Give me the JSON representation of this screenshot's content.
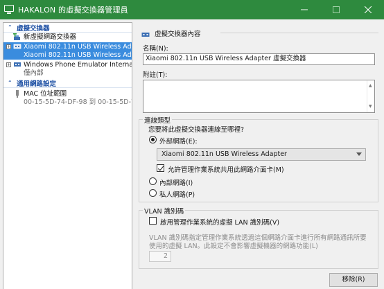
{
  "window": {
    "title": "HAKALON 的虛擬交換器管理員",
    "accent": "#2e8a3e",
    "controls": {
      "minimize_icon": "minimize-icon",
      "maximize_icon": "maximize-icon",
      "close_icon": "close-icon"
    }
  },
  "sidebar": {
    "section_switches": "虛擬交換器",
    "new_switch": "新虛擬網路交換器",
    "switches": [
      {
        "name": "Xiaomi 802.11n USB Wireless Adapt...",
        "sub": "Xiaomi 802.11n USB Wireless Adap...",
        "selected": true,
        "expanded": true
      },
      {
        "name": "Windows Phone Emulator Internal ...",
        "sub": "僅內部",
        "selected": false,
        "expanded": true
      }
    ],
    "section_global": "通用網路設定",
    "mac_range": {
      "name": "MAC 位址範圍",
      "sub": "00-15-5D-74-DF-98 到 00-15-5D-7..."
    },
    "selection_color": "#3a8cde"
  },
  "detail": {
    "section_title": "虛擬交換器內容",
    "name_label": "名稱(N):",
    "name_value": "Xiaomi 802.11n USB Wireless Adapter 虛擬交換器",
    "notes_label": "附註(T):",
    "notes_value": "",
    "connection": {
      "group_title": "連線類型",
      "question": "您要將此虛擬交換器連線至哪裡?",
      "external_label": "外部網路(E):",
      "external_selected": true,
      "adapter_value": "Xiaomi 802.11n USB Wireless Adapter",
      "allow_mgmt_label": "允許管理作業系統共用此網路介面卡(M)",
      "allow_mgmt_checked": true,
      "internal_label": "內部網路(I)",
      "private_label": "私人網路(P)"
    },
    "vlan": {
      "group_title": "VLAN 識別碼",
      "enable_label": "啟用管理作業系統的虛擬 LAN 識別碼(V)",
      "enable_checked": false,
      "description_line1": "VLAN 識別碼指定管理作業系統透過這個網路介面卡進行所有網路通訊所要",
      "description_line2": "使用的虛擬 LAN。此設定不會影響虛擬機器的網路功能(L)",
      "vlan_id": "2"
    },
    "remove_button": "移除(R)"
  }
}
